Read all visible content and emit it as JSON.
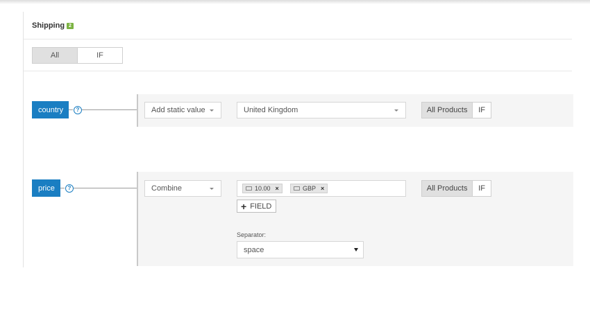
{
  "section": {
    "title": "Shipping",
    "badge": "2"
  },
  "top_toggle": {
    "all_label": "All",
    "if_label": "IF"
  },
  "rows": [
    {
      "field": "country",
      "help": "?",
      "mode": "Add static value",
      "value": "United Kingdom",
      "scope_all": "All Products",
      "scope_if": "IF"
    },
    {
      "field": "price",
      "help": "?",
      "mode": "Combine",
      "chips": [
        {
          "label": "10.00",
          "remove": "×"
        },
        {
          "label": "GBP",
          "remove": "×"
        }
      ],
      "add_field": {
        "plus": "+",
        "label": "FIELD"
      },
      "separator_label": "Separator:",
      "separator_value": "space",
      "scope_all": "All Products",
      "scope_if": "IF"
    }
  ],
  "colors": {
    "accent": "#1a7ec2",
    "badge": "#7cb342",
    "row_bg": "#f5f5f5"
  },
  "icons": {
    "help": "question-circle-icon",
    "chip": "keyboard-icon",
    "remove": "close-icon",
    "add": "plus-icon",
    "dropdown": "caret-down-icon"
  }
}
